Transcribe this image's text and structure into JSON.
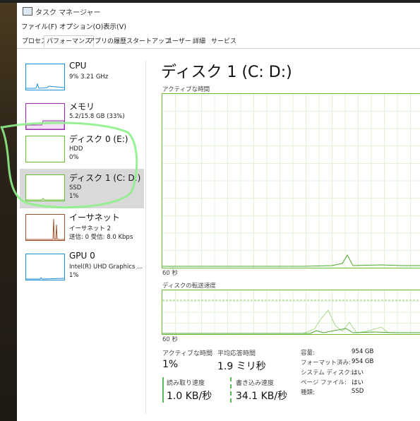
{
  "window": {
    "title": "タスク マネージャー"
  },
  "menu": {
    "items": [
      "ファイル(F)",
      "オプション(O)",
      "表示(V)"
    ]
  },
  "tabs": [
    {
      "label": "プロセス"
    },
    {
      "label": "パフォーマンス",
      "active": true
    },
    {
      "label": "アプリの履歴"
    },
    {
      "label": "スタートアップ"
    },
    {
      "label": "ユーザー"
    },
    {
      "label": "詳細"
    },
    {
      "label": "サービス"
    }
  ],
  "sidebar": {
    "items": [
      {
        "title": "CPU",
        "line1": "9%  3.21 GHz",
        "line2": "",
        "color": "#1e90d8"
      },
      {
        "title": "メモリ",
        "line1": "5.2/15.8 GB (33%)",
        "line2": "",
        "color": "#9b2fae"
      },
      {
        "title": "ディスク 0 (E:)",
        "line1": "HDD",
        "line2": "0%",
        "color": "#6abf3a"
      },
      {
        "title": "ディスク 1 (C: D:)",
        "line1": "SSD",
        "line2": "1%",
        "color": "#6abf3a",
        "selected": true
      },
      {
        "title": "イーサネット",
        "line1": "イーサネット 2",
        "line2": "送信: 0  受信: 8.0 Kbps",
        "color": "#a0522d"
      },
      {
        "title": "GPU 0",
        "line1": "Intel(R) UHD Graphics ...",
        "line2": "1%",
        "color": "#1e90d8"
      }
    ]
  },
  "main": {
    "title": "ディスク 1 (C: D:)",
    "graph1_label": "アクティブな時間",
    "graph1_time": "60 秒",
    "graph2_label": "ディスクの転送速度",
    "graph2_time": "60 秒",
    "accent": "#6abf3a"
  },
  "stats": {
    "active_label": "アクティブな時間",
    "active_value": "1%",
    "response_label": "平均応答時間",
    "response_value": "1.9 ミリ秒",
    "read_label": "読み取り速度",
    "read_value": "1.0 KB/秒",
    "write_label": "書き込み速度",
    "write_value": "34.1 KB/秒"
  },
  "properties": [
    {
      "key": "容量:",
      "value": "954 GB"
    },
    {
      "key": "フォーマット済み:",
      "value": "954 GB"
    },
    {
      "key": "システム ディスク:",
      "value": "はい"
    },
    {
      "key": "ページ ファイル:",
      "value": "はい"
    },
    {
      "key": "種類:",
      "value": "SSD"
    }
  ]
}
